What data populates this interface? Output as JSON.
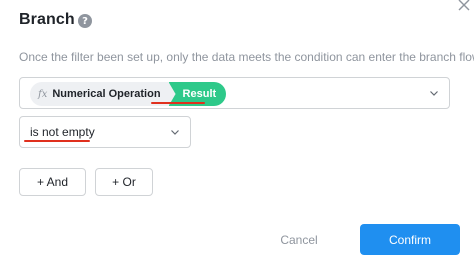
{
  "dialog": {
    "title": "Branch",
    "help_icon": "question-circle-icon",
    "close_icon": "close-icon",
    "description": "Once the filter been set up, only the data meets the condition can enter the branch flow"
  },
  "field_select": {
    "fx_label": "fx",
    "field_label": "Numerical Operation",
    "result_label": "Result",
    "result_color": "#2ec98a",
    "chevron_icon": "chevron-down-icon"
  },
  "condition_select": {
    "value": "is not empty",
    "chevron_icon": "chevron-down-icon"
  },
  "buttons": {
    "and_label": "+ And",
    "or_label": "+ Or",
    "cancel_label": "Cancel",
    "confirm_label": "Confirm",
    "confirm_color": "#1f8ff0"
  },
  "annotations": {
    "underline_color": "#e0301e"
  }
}
